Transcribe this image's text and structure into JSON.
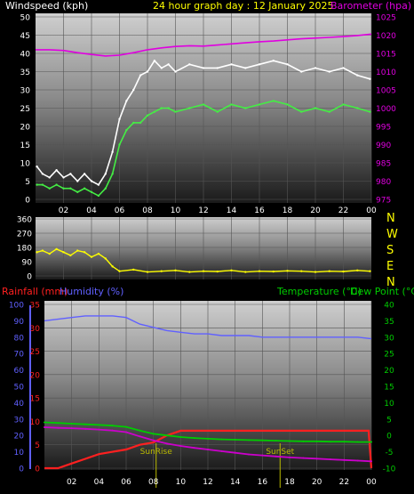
{
  "header": {
    "wind_label": "Windspeed (kph)",
    "title": "24 hour graph day : 12 January 2025",
    "baro_label": "Barometer (hpa)"
  },
  "colors": {
    "wind": "#ffffff",
    "gust": "#44ee44",
    "barometer": "#e000e0",
    "direction": "#ffff00",
    "rain": "#ff2020",
    "humidity": "#6060ff",
    "temperature": "#00cc00",
    "dewpoint": "#cc00cc",
    "sun_markers": "#bbbb00"
  },
  "compass": [
    "N",
    "W",
    "S",
    "E",
    "N"
  ],
  "bottom": {
    "rain_label": "Rainfall (mm)",
    "humidity_label": "Humidity (%)",
    "temp_label": "Temperature (°C)",
    "dew_label": "Dew Point (°C)",
    "sunrise_label": "SunRise",
    "sunset_label": "SunSet"
  },
  "chart_data": [
    {
      "type": "line",
      "x_ticks": [
        "02",
        "04",
        "06",
        "08",
        "10",
        "12",
        "14",
        "16",
        "18",
        "20",
        "22",
        "00"
      ],
      "xlim": [
        0,
        24
      ],
      "y_left": {
        "label": "Windspeed (kph)",
        "ylim": [
          0,
          50
        ],
        "ticks": [
          "0",
          "5",
          "10",
          "15",
          "20",
          "25",
          "30",
          "35",
          "40",
          "45",
          "50"
        ]
      },
      "y_right": {
        "label": "Barometer (hpa)",
        "ylim": [
          975,
          1025
        ],
        "ticks": [
          "975",
          "980",
          "985",
          "990",
          "995",
          "1000",
          "1005",
          "1010",
          "1015",
          "1020",
          "1025"
        ]
      },
      "series": [
        {
          "name": "Windspeed (kph)",
          "axis": "left",
          "x": [
            0.1,
            0.5,
            1,
            1.5,
            2,
            2.5,
            3,
            3.5,
            4,
            4.5,
            5,
            5.5,
            6,
            6.5,
            7,
            7.5,
            8,
            8.5,
            9,
            9.5,
            10,
            11,
            12,
            13,
            14,
            15,
            16,
            17,
            18,
            19,
            20,
            21,
            22,
            23,
            23.9
          ],
          "y": [
            9,
            7,
            6,
            8,
            6,
            7,
            5,
            7,
            5,
            4,
            7,
            13,
            22,
            27,
            30,
            34,
            35,
            38,
            36,
            37,
            35,
            37,
            36,
            36,
            37,
            36,
            37,
            38,
            37,
            35,
            36,
            35,
            36,
            34,
            33
          ]
        },
        {
          "name": "Wind gust",
          "axis": "left",
          "x": [
            0.1,
            0.5,
            1,
            1.5,
            2,
            2.5,
            3,
            3.5,
            4,
            4.5,
            5,
            5.5,
            6,
            6.5,
            7,
            7.5,
            8,
            8.5,
            9,
            9.5,
            10,
            11,
            12,
            13,
            14,
            15,
            16,
            17,
            18,
            19,
            20,
            21,
            22,
            23,
            23.9
          ],
          "y": [
            4,
            4,
            3,
            4,
            3,
            3,
            2,
            3,
            2,
            1,
            3,
            7,
            15,
            19,
            21,
            21,
            23,
            24,
            25,
            25,
            24,
            25,
            26,
            24,
            26,
            25,
            26,
            27,
            26,
            24,
            25,
            24,
            26,
            25,
            24
          ]
        },
        {
          "name": "Barometer (hpa)",
          "axis": "right",
          "x": [
            0,
            1,
            2,
            3,
            4,
            5,
            6,
            7,
            8,
            9,
            10,
            11,
            12,
            13,
            14,
            15,
            16,
            17,
            18,
            19,
            20,
            21,
            22,
            23,
            24
          ],
          "y": [
            1016,
            1016,
            1015.8,
            1015.2,
            1014.7,
            1014.3,
            1014.5,
            1015.2,
            1016,
            1016.5,
            1016.9,
            1017.1,
            1017.0,
            1017.3,
            1017.6,
            1017.9,
            1018.2,
            1018.4,
            1018.7,
            1019.0,
            1019.2,
            1019.4,
            1019.6,
            1019.9,
            1020.3
          ]
        }
      ]
    },
    {
      "type": "line",
      "x_ticks": [],
      "xlim": [
        0,
        24
      ],
      "y_left": {
        "ylim": [
          0,
          360
        ],
        "ticks": [
          "0",
          "90",
          "180",
          "270",
          "360"
        ]
      },
      "series": [
        {
          "name": "Wind direction",
          "x": [
            0.1,
            0.5,
            1,
            1.5,
            2,
            2.5,
            3,
            3.5,
            4,
            4.5,
            5,
            5.5,
            6,
            7,
            8,
            9,
            10,
            11,
            12,
            13,
            14,
            15,
            16,
            17,
            18,
            19,
            20,
            21,
            22,
            23,
            23.9
          ],
          "y": [
            150,
            160,
            140,
            170,
            150,
            130,
            160,
            150,
            120,
            140,
            110,
            60,
            30,
            40,
            25,
            30,
            35,
            25,
            30,
            28,
            35,
            25,
            30,
            28,
            32,
            30,
            25,
            30,
            28,
            35,
            30
          ]
        }
      ]
    },
    {
      "type": "line",
      "x_ticks": [
        "02",
        "04",
        "06",
        "08",
        "10",
        "12",
        "14",
        "16",
        "18",
        "20",
        "22",
        "00"
      ],
      "xlim": [
        0,
        24
      ],
      "y_left_outer": {
        "label": "Humidity (%)",
        "ylim": [
          0,
          100
        ],
        "ticks": [
          "0",
          "10",
          "20",
          "30",
          "40",
          "50",
          "60",
          "70",
          "80",
          "90",
          "100"
        ]
      },
      "y_left_inner": {
        "label": "Rainfall (mm)",
        "ylim": [
          0,
          35
        ],
        "ticks": [
          "0",
          "5",
          "10",
          "15",
          "20",
          "25",
          "30",
          "35"
        ]
      },
      "y_right": {
        "label": "Temperature (°C)",
        "ylim": [
          -10,
          40
        ],
        "ticks": [
          "-10",
          "-5",
          "0",
          "5",
          "10",
          "15",
          "20",
          "25",
          "30",
          "35",
          "40"
        ]
      },
      "series": [
        {
          "name": "Humidity (%)",
          "axis": "left_outer",
          "x": [
            0,
            1,
            2,
            3,
            4,
            5,
            6,
            7,
            8,
            9,
            10,
            11,
            12,
            13,
            14,
            15,
            16,
            17,
            18,
            19,
            20,
            21,
            22,
            23,
            24
          ],
          "y": [
            90,
            91,
            92,
            93,
            93,
            93,
            92,
            88,
            86,
            84,
            83,
            82,
            82,
            81,
            81,
            81,
            80,
            80,
            80,
            80,
            80,
            80,
            80,
            80,
            79
          ]
        },
        {
          "name": "Rainfall (mm)",
          "axis": "left_inner",
          "x": [
            0,
            1,
            2,
            3,
            4,
            5,
            6,
            7,
            8,
            9,
            10,
            11,
            12,
            14,
            16,
            18,
            20,
            22,
            23.8,
            24
          ],
          "y": [
            0,
            0,
            1,
            2,
            3,
            3.5,
            4,
            5,
            5.5,
            7,
            8,
            8,
            8,
            8,
            8,
            8,
            8,
            8,
            8,
            0
          ]
        },
        {
          "name": "Temperature (°C)",
          "axis": "right",
          "x": [
            0,
            1,
            2,
            3,
            4,
            5,
            6,
            7,
            8,
            9,
            10,
            11,
            12,
            13,
            14,
            15,
            16,
            17,
            18,
            19,
            20,
            21,
            22,
            23,
            24
          ],
          "y": [
            4,
            3.8,
            3.6,
            3.4,
            3.2,
            3,
            2.6,
            1.5,
            0.5,
            0,
            -0.5,
            -0.8,
            -1,
            -1.2,
            -1.3,
            -1.4,
            -1.5,
            -1.6,
            -1.7,
            -1.8,
            -1.8,
            -1.9,
            -1.9,
            -2,
            -2
          ]
        },
        {
          "name": "Dew Point (°C)",
          "axis": "right",
          "x": [
            0,
            1,
            2,
            3,
            4,
            5,
            6,
            7,
            8,
            9,
            10,
            11,
            12,
            13,
            14,
            15,
            16,
            17,
            18,
            19,
            20,
            21,
            22,
            23,
            24
          ],
          "y": [
            2.5,
            2.3,
            2.2,
            2.0,
            1.8,
            1.5,
            1.0,
            -0.3,
            -1.5,
            -2.5,
            -3.2,
            -3.8,
            -4.3,
            -4.8,
            -5.3,
            -5.8,
            -6.1,
            -6.4,
            -6.7,
            -6.9,
            -7.1,
            -7.3,
            -7.5,
            -7.7,
            -7.9
          ]
        }
      ],
      "markers": [
        {
          "label": "SunRise",
          "x": 8.2
        },
        {
          "label": "SunSet",
          "x": 17.3
        }
      ]
    }
  ]
}
